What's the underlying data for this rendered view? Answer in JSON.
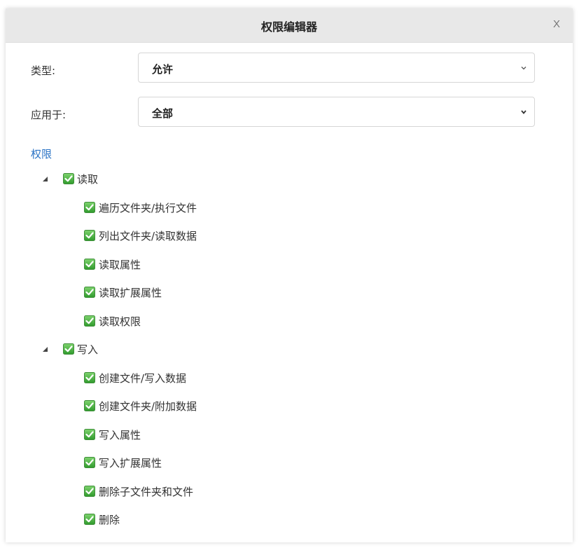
{
  "dialog": {
    "title": "权限编辑器",
    "close_label": "X"
  },
  "type_field": {
    "label": "类型:",
    "value": "允许"
  },
  "apply_field": {
    "label": "应用于:",
    "value": "全部"
  },
  "permissions": {
    "title": "权限",
    "groups": [
      {
        "label": "读取",
        "checked": true,
        "expanded": true,
        "items": [
          {
            "label": "遍历文件夹/执行文件",
            "checked": true
          },
          {
            "label": "列出文件夹/读取数据",
            "checked": true
          },
          {
            "label": "读取属性",
            "checked": true
          },
          {
            "label": "读取扩展属性",
            "checked": true
          },
          {
            "label": "读取权限",
            "checked": true
          }
        ]
      },
      {
        "label": "写入",
        "checked": true,
        "expanded": true,
        "items": [
          {
            "label": "创建文件/写入数据",
            "checked": true
          },
          {
            "label": "创建文件夹/附加数据",
            "checked": true
          },
          {
            "label": "写入属性",
            "checked": true
          },
          {
            "label": "写入扩展属性",
            "checked": true
          },
          {
            "label": "删除子文件夹和文件",
            "checked": true
          },
          {
            "label": "删除",
            "checked": true
          }
        ]
      }
    ]
  },
  "colors": {
    "accent": "#2a73c5",
    "checkbox_green": "#3fae3b"
  },
  "icons": {
    "checkbox": "checkbox-checked-icon",
    "expand": "triangle-expanded-icon",
    "dropdown": "chevron-down-icon",
    "close": "close-icon"
  }
}
